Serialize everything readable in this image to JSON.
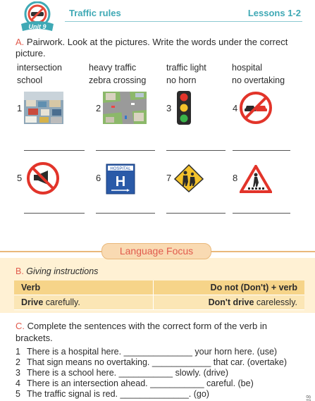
{
  "header": {
    "unit": "Unit 9",
    "title": "Traffic rules",
    "lessons": "Lessons 1-2"
  },
  "section_a": {
    "letter": "A.",
    "instruction": "Pairwork. Look at the pictures. Write the words under the correct picture.",
    "words": [
      "intersection",
      "heavy traffic",
      "traffic light",
      "hospital",
      "school",
      "zebra crossing",
      "no horn",
      "no overtaking"
    ],
    "pictures": [
      {
        "num": "1",
        "icon": "heavy-traffic-photo"
      },
      {
        "num": "2",
        "icon": "intersection-photo"
      },
      {
        "num": "3",
        "icon": "traffic-light-icon"
      },
      {
        "num": "4",
        "icon": "no-overtaking-sign-icon"
      },
      {
        "num": "5",
        "icon": "no-horn-sign-icon"
      },
      {
        "num": "6",
        "icon": "hospital-sign-icon"
      },
      {
        "num": "7",
        "icon": "school-sign-icon"
      },
      {
        "num": "8",
        "icon": "zebra-crossing-sign-icon"
      }
    ],
    "hospital_sign_text": "HOSPITAL",
    "hospital_sign_letter": "H"
  },
  "focus": {
    "banner": "Language Focus",
    "letter": "B.",
    "title": "Giving instructions",
    "col1": "Verb",
    "col2": "Do not (Don't) + verb",
    "row_left_bold": "Drive",
    "row_left_rest": " carefully.",
    "row_right_bold": "Don't drive",
    "row_right_rest": " carelessly."
  },
  "section_c": {
    "letter": "C.",
    "instruction": "Complete the sentences with the correct form of the verb in brackets.",
    "sentences": [
      {
        "num": "1",
        "text": "There is a hospital here. ______________ your horn here. (use)"
      },
      {
        "num": "2",
        "text": "That sign means no overtaking. ____________ that car. (overtake)"
      },
      {
        "num": "3",
        "text": "There is a school here. ___________ slowly. (drive)"
      },
      {
        "num": "4",
        "text": "There is an intersection ahead. ___________ careful. (be)"
      },
      {
        "num": "5",
        "text": "The traffic signal is red. ______________. (go)"
      }
    ]
  },
  "page_year": "2018",
  "colors": {
    "accent": "#3fa9b5",
    "letter": "#e15b4d",
    "focus_bg": "#fff1d4",
    "table_head": "#f6d489",
    "table_row": "#fbe6b5"
  }
}
